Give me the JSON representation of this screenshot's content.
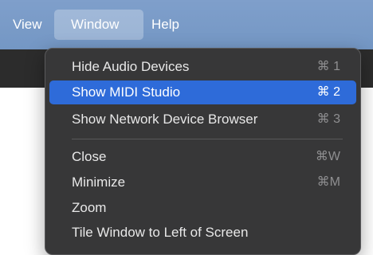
{
  "menubar": {
    "items": [
      {
        "label": "View"
      },
      {
        "label": "Window",
        "active": true
      },
      {
        "label": "Help"
      }
    ]
  },
  "window_menu": {
    "groups": [
      [
        {
          "label": "Hide Audio Devices",
          "shortcut": "⌘ 1"
        },
        {
          "label": "Show MIDI Studio",
          "shortcut": "⌘ 2",
          "highlighted": true
        },
        {
          "label": "Show Network Device Browser",
          "shortcut": "⌘ 3"
        }
      ],
      [
        {
          "label": "Close",
          "shortcut": "⌘W"
        },
        {
          "label": "Minimize",
          "shortcut": "⌘M"
        },
        {
          "label": "Zoom",
          "shortcut": ""
        },
        {
          "label": "Tile Window to Left of Screen",
          "shortcut": ""
        }
      ]
    ]
  },
  "colors": {
    "menubar_bg": "#7a9cc8",
    "menu_bg": "#373738",
    "highlight": "#2e6bd9",
    "window_dark": "#2c2c2c"
  }
}
